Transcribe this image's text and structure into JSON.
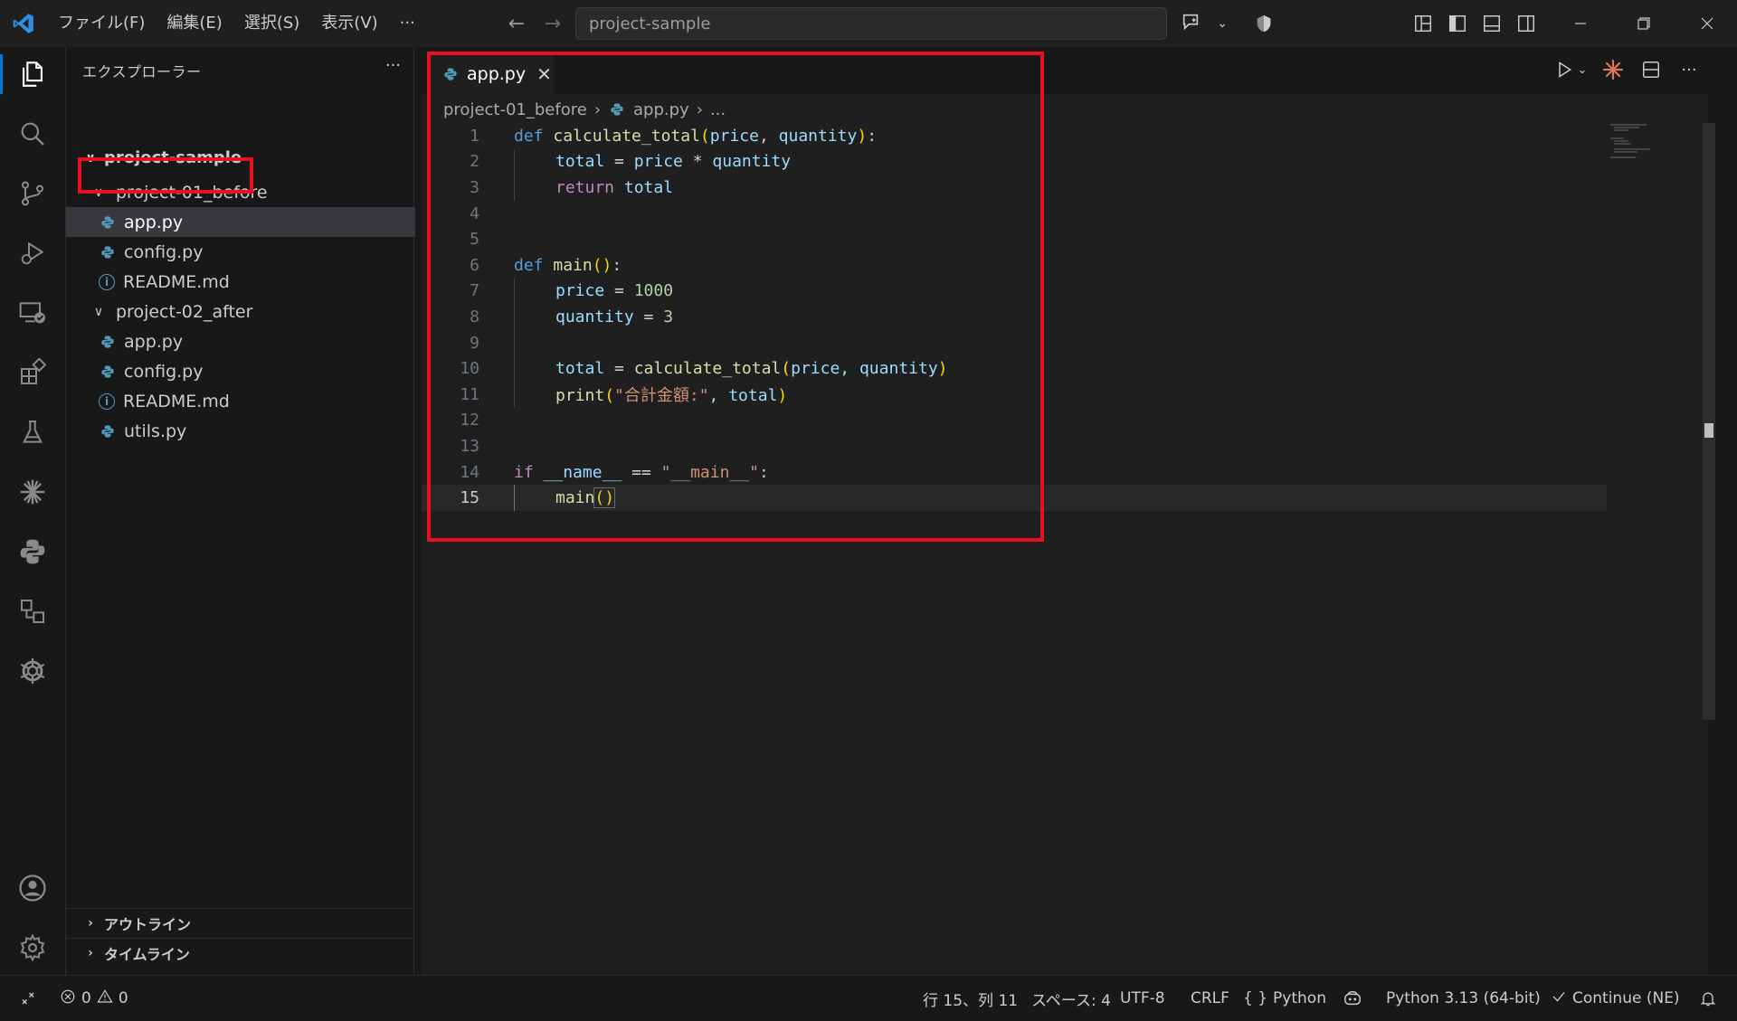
{
  "titlebar": {
    "menu": [
      "ファイル(F)",
      "編集(E)",
      "選択(S)",
      "表示(V)",
      "···"
    ],
    "search_text": "project-sample"
  },
  "sidebar": {
    "title": "エクスプローラー",
    "more": "···",
    "root": "project-sample",
    "folders": [
      {
        "name": "project-01_before",
        "files": [
          {
            "name": "app.py",
            "type": "python"
          },
          {
            "name": "config.py",
            "type": "python"
          },
          {
            "name": "README.md",
            "type": "info"
          }
        ]
      },
      {
        "name": "project-02_after",
        "files": [
          {
            "name": "app.py",
            "type": "python"
          },
          {
            "name": "config.py",
            "type": "python"
          },
          {
            "name": "README.md",
            "type": "info"
          },
          {
            "name": "utils.py",
            "type": "python"
          }
        ]
      }
    ],
    "outline": "アウトライン",
    "timeline": "タイムライン"
  },
  "editor": {
    "tab_label": "app.py",
    "breadcrumb": [
      "project-01_before",
      "app.py",
      "..."
    ],
    "line_numbers": [
      "1",
      "2",
      "3",
      "4",
      "5",
      "6",
      "7",
      "8",
      "9",
      "10",
      "11",
      "12",
      "13",
      "14",
      "15"
    ],
    "current_line": 15,
    "code": {
      "l1": {
        "def": "def",
        "name": "calculate_total",
        "open": "(",
        "p1": "price",
        "comma": ", ",
        "p2": "quantity",
        "close": ")",
        "colon": ":"
      },
      "l2": {
        "var": "total",
        "eq": " = ",
        "a": "price",
        "op": " * ",
        "b": "quantity"
      },
      "l3": {
        "ret": "return",
        "val": " total"
      },
      "l6": {
        "def": "def",
        "name": "main",
        "parens": "()",
        "colon": ":"
      },
      "l7": {
        "var": "price",
        "eq": " = ",
        "val": "1000"
      },
      "l8": {
        "var": "quantity",
        "eq": " = ",
        "val": "3"
      },
      "l10": {
        "var": "total",
        "eq": " = ",
        "fn": "calculate_total",
        "open": "(",
        "args": "price, quantity",
        "close": ")"
      },
      "l11": {
        "fn": "print",
        "open": "(",
        "str": "\"合計金額:\"",
        "rest": ", total",
        "close": ")"
      },
      "l14": {
        "if": "if",
        "a": " __name__ ",
        "eq": "==",
        "str": " \"__main__\"",
        "colon": ":"
      },
      "l15": {
        "fn": "main",
        "parens": "()"
      }
    }
  },
  "statusbar": {
    "errors": "0",
    "warnings": "0",
    "position": "行 15、列 11",
    "spaces": "スペース: 4",
    "encoding": "UTF-8",
    "eol": "CRLF",
    "language_braces": "{ }",
    "language": "Python",
    "interpreter": "Python 3.13 (64-bit)",
    "continue": "Continue (NE)"
  },
  "colors": {
    "accent": "#0078d4",
    "highlight_box": "#e81123",
    "python_icon": "#519aba"
  }
}
